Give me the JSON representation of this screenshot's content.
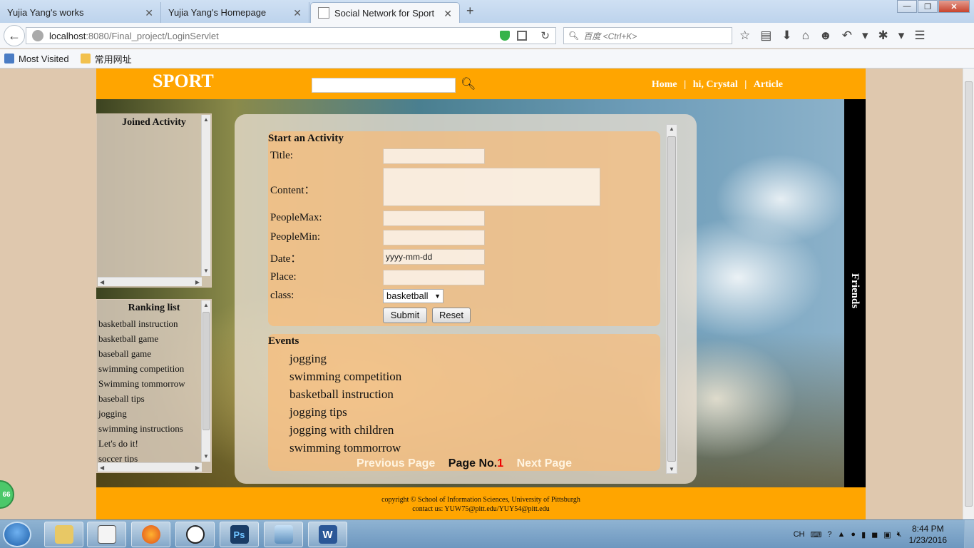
{
  "browser": {
    "tabs": [
      {
        "label": "Yujia Yang's works",
        "active": false
      },
      {
        "label": "Yujia Yang's Homepage",
        "active": false
      },
      {
        "label": "Social Network for Sport",
        "active": true
      }
    ],
    "url_host": "localhost",
    "url_path": ":8080/Final_project/LoginServlet",
    "search_placeholder": "百度 <Ctrl+K>",
    "bookmarks": [
      "Most Visited",
      "常用网址"
    ]
  },
  "site": {
    "logo": "SPORT",
    "nav": {
      "home": "Home",
      "user": "hi, Crystal",
      "article": "Article",
      "sep": "|"
    },
    "friends_label": "Friends",
    "joined_title": "Joined Activity",
    "ranking_title": "Ranking list",
    "ranking_items": [
      "basketball instruction",
      "basketball game",
      "baseball game",
      "swimming competition",
      "Swimming tommorrow",
      "baseball tips",
      "jogging",
      "swimming instructions",
      "Let's do it!",
      "soccer tips"
    ],
    "form": {
      "title": "Start an Activity",
      "labels": {
        "title": "Title:",
        "content": "Content：",
        "people_max": "PeopleMax:",
        "people_min": "PeopleMin:",
        "date": "Date：",
        "place": "Place:",
        "class": "class:"
      },
      "date_placeholder": "yyyy-mm-dd",
      "class_value": "basketball",
      "submit": "Submit",
      "reset": "Reset"
    },
    "events": {
      "title": "Events",
      "items": [
        "jogging",
        "swimming competition",
        "basketball instruction",
        "jogging tips",
        "jogging with children",
        "swimming tommorrow"
      ],
      "prev": "Previous Page",
      "page_label": "Page No.",
      "page_num": "1",
      "next": "Next Page"
    },
    "footer": {
      "line1": "copyright © School of Information Sciences, University of Pittsburgh",
      "line2": "contact us: YUW75@pitt.edu/YUY54@pitt.edu"
    }
  },
  "side_badge": "66",
  "taskbar": {
    "lang": "CH",
    "time": "8:44 PM",
    "date": "1/23/2016"
  }
}
